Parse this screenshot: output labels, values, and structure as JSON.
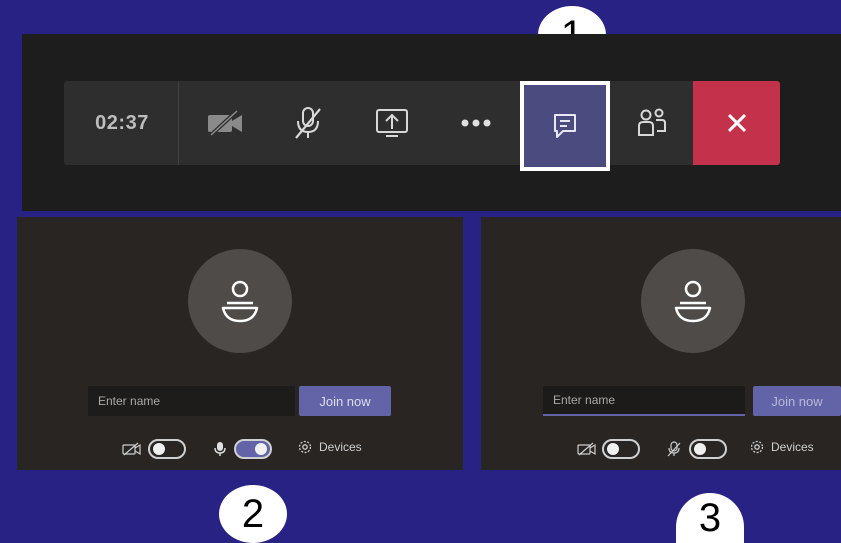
{
  "toolbar": {
    "timer": "02:37",
    "buttons": [
      {
        "name": "camera-off",
        "icon": "video-off-icon"
      },
      {
        "name": "mic-off",
        "icon": "mic-off-icon"
      },
      {
        "name": "share-screen",
        "icon": "share-screen-icon"
      },
      {
        "name": "more-actions",
        "icon": "more-dots-icon"
      },
      {
        "name": "show-conversation",
        "icon": "chat-icon",
        "highlighted": true
      },
      {
        "name": "show-participants",
        "icon": "participants-icon"
      },
      {
        "name": "hang-up",
        "icon": "close-icon"
      }
    ],
    "hangup_color": "#c4314b",
    "highlight_color": "#4b4b80"
  },
  "callouts": {
    "one": "1",
    "two": "2",
    "three": "3"
  },
  "prejoin_left": {
    "name_placeholder": "Enter name",
    "join_label": "Join now",
    "camera_on": false,
    "mic_on": true,
    "devices_label": "Devices"
  },
  "prejoin_right": {
    "name_placeholder": "Enter name",
    "join_label": "Join now",
    "camera_on": false,
    "mic_on": false,
    "devices_label": "Devices"
  },
  "colors": {
    "background": "#272283",
    "accent": "#6264a7"
  }
}
